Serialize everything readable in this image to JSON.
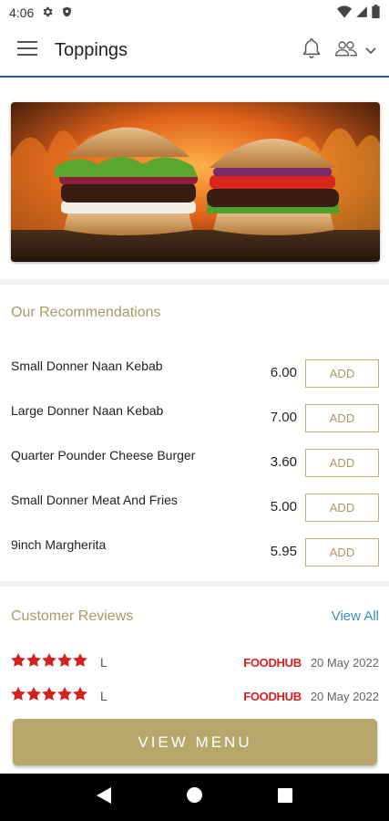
{
  "status_bar": {
    "time": "4:06"
  },
  "app_bar": {
    "title": "Toppings"
  },
  "recommendations": {
    "title": "Our Recommendations",
    "items": [
      {
        "name": "Small Donner Naan Kebab",
        "price": "6.00",
        "add_label": "ADD"
      },
      {
        "name": "Large Donner Naan Kebab",
        "price": "7.00",
        "add_label": "ADD"
      },
      {
        "name": "Quarter Pounder Cheese Burger",
        "price": "3.60",
        "add_label": "ADD"
      },
      {
        "name": "Small Donner Meat And Fries",
        "price": "5.00",
        "add_label": "ADD"
      },
      {
        "name": "9inch Margherita",
        "price": "5.95",
        "add_label": "ADD"
      }
    ]
  },
  "reviews": {
    "title": "Customer Reviews",
    "view_all_label": "View All",
    "items": [
      {
        "rating": 5,
        "user": "L",
        "source": "FOODHUB",
        "date": "20 May 2022"
      },
      {
        "rating": 5,
        "user": "L",
        "source": "FOODHUB",
        "date": "20 May 2022"
      }
    ]
  },
  "view_menu_label": "VIEW MENU",
  "colors": {
    "accent_gold": "#b8a76a",
    "link_blue": "#3a8dc4",
    "star_red": "#d61f1f",
    "divider_blue": "#2f55b4"
  }
}
